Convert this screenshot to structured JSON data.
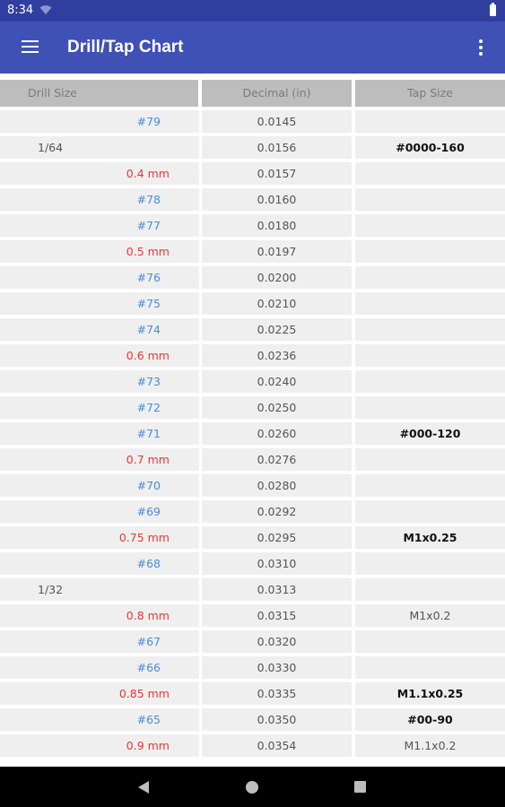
{
  "status_bar": {
    "time": "8:34"
  },
  "app_bar": {
    "title": "Drill/Tap Chart"
  },
  "table": {
    "headers": {
      "drill_size": "Drill Size",
      "decimal": "Decimal (in)",
      "tap_size": "Tap Size"
    },
    "rows": [
      {
        "drill": "#79",
        "kind": "number",
        "decimal": "0.0145",
        "tap": "",
        "tap_bold": false
      },
      {
        "drill": "1/64",
        "kind": "fraction",
        "decimal": "0.0156",
        "tap": "#0000-160",
        "tap_bold": true
      },
      {
        "drill": "0.4 mm",
        "kind": "metric",
        "decimal": "0.0157",
        "tap": "",
        "tap_bold": false
      },
      {
        "drill": "#78",
        "kind": "number",
        "decimal": "0.0160",
        "tap": "",
        "tap_bold": false
      },
      {
        "drill": "#77",
        "kind": "number",
        "decimal": "0.0180",
        "tap": "",
        "tap_bold": false
      },
      {
        "drill": "0.5 mm",
        "kind": "metric",
        "decimal": "0.0197",
        "tap": "",
        "tap_bold": false
      },
      {
        "drill": "#76",
        "kind": "number",
        "decimal": "0.0200",
        "tap": "",
        "tap_bold": false
      },
      {
        "drill": "#75",
        "kind": "number",
        "decimal": "0.0210",
        "tap": "",
        "tap_bold": false
      },
      {
        "drill": "#74",
        "kind": "number",
        "decimal": "0.0225",
        "tap": "",
        "tap_bold": false
      },
      {
        "drill": "0.6 mm",
        "kind": "metric",
        "decimal": "0.0236",
        "tap": "",
        "tap_bold": false
      },
      {
        "drill": "#73",
        "kind": "number",
        "decimal": "0.0240",
        "tap": "",
        "tap_bold": false
      },
      {
        "drill": "#72",
        "kind": "number",
        "decimal": "0.0250",
        "tap": "",
        "tap_bold": false
      },
      {
        "drill": "#71",
        "kind": "number",
        "decimal": "0.0260",
        "tap": "#000-120",
        "tap_bold": true
      },
      {
        "drill": "0.7 mm",
        "kind": "metric",
        "decimal": "0.0276",
        "tap": "",
        "tap_bold": false
      },
      {
        "drill": "#70",
        "kind": "number",
        "decimal": "0.0280",
        "tap": "",
        "tap_bold": false
      },
      {
        "drill": "#69",
        "kind": "number",
        "decimal": "0.0292",
        "tap": "",
        "tap_bold": false
      },
      {
        "drill": "0.75 mm",
        "kind": "metric",
        "decimal": "0.0295",
        "tap": "M1x0.25",
        "tap_bold": true
      },
      {
        "drill": "#68",
        "kind": "number",
        "decimal": "0.0310",
        "tap": "",
        "tap_bold": false
      },
      {
        "drill": "1/32",
        "kind": "fraction",
        "decimal": "0.0313",
        "tap": "",
        "tap_bold": false
      },
      {
        "drill": "0.8 mm",
        "kind": "metric",
        "decimal": "0.0315",
        "tap": "M1x0.2",
        "tap_bold": false
      },
      {
        "drill": "#67",
        "kind": "number",
        "decimal": "0.0320",
        "tap": "",
        "tap_bold": false
      },
      {
        "drill": "#66",
        "kind": "number",
        "decimal": "0.0330",
        "tap": "",
        "tap_bold": false
      },
      {
        "drill": "0.85 mm",
        "kind": "metric",
        "decimal": "0.0335",
        "tap": "M1.1x0.25",
        "tap_bold": true
      },
      {
        "drill": "#65",
        "kind": "number",
        "decimal": "0.0350",
        "tap": "#00-90",
        "tap_bold": true
      },
      {
        "drill": "0.9 mm",
        "kind": "metric",
        "decimal": "0.0354",
        "tap": "M1.1x0.2",
        "tap_bold": false
      }
    ]
  },
  "colors": {
    "status_bar": "#303f9f",
    "app_bar": "#3f51b5",
    "number_size": "#4a8cd4",
    "metric_size": "#e53935",
    "header_bg": "#bdbdbd",
    "row_bg": "#efefef"
  },
  "icons": {
    "menu": "hamburger-menu-icon",
    "more": "more-vert-icon",
    "wifi": "wifi-icon",
    "battery": "battery-icon",
    "back": "back-triangle-icon",
    "home": "home-circle-icon",
    "recent": "recent-apps-square-icon"
  }
}
